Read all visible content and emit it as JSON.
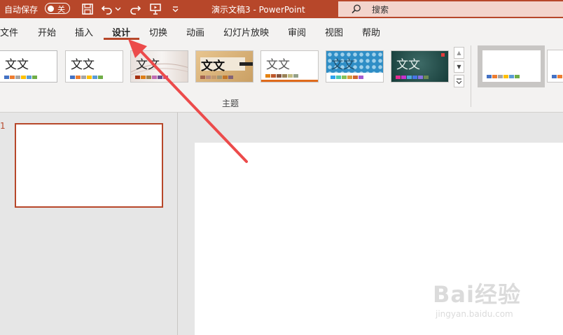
{
  "titlebar": {
    "autosave_label": "自动保存",
    "autosave_state": "关",
    "doc_title": "演示文稿3  -  PowerPoint",
    "search_placeholder": "搜索"
  },
  "tabs": [
    {
      "label": "文件"
    },
    {
      "label": "开始"
    },
    {
      "label": "插入"
    },
    {
      "label": "设计",
      "active": true
    },
    {
      "label": "切换"
    },
    {
      "label": "动画"
    },
    {
      "label": "幻灯片放映"
    },
    {
      "label": "审阅"
    },
    {
      "label": "视图"
    },
    {
      "label": "帮助"
    }
  ],
  "ribbon": {
    "group_label": "主题",
    "themes": [
      {
        "text": "文文"
      },
      {
        "text": "文文"
      },
      {
        "text": "文文"
      },
      {
        "text": "文文"
      },
      {
        "text": "文文"
      },
      {
        "text": "文文"
      },
      {
        "text": "文文"
      }
    ]
  },
  "slides_pane": {
    "slide_number": "1"
  },
  "watermark": {
    "brand": "Bai经验",
    "url": "jingyan.baidu.com"
  },
  "colors": {
    "accent": "#b7472a",
    "ribbon_bg": "#f3f2f1",
    "workspace_bg": "#e6e6e6"
  }
}
